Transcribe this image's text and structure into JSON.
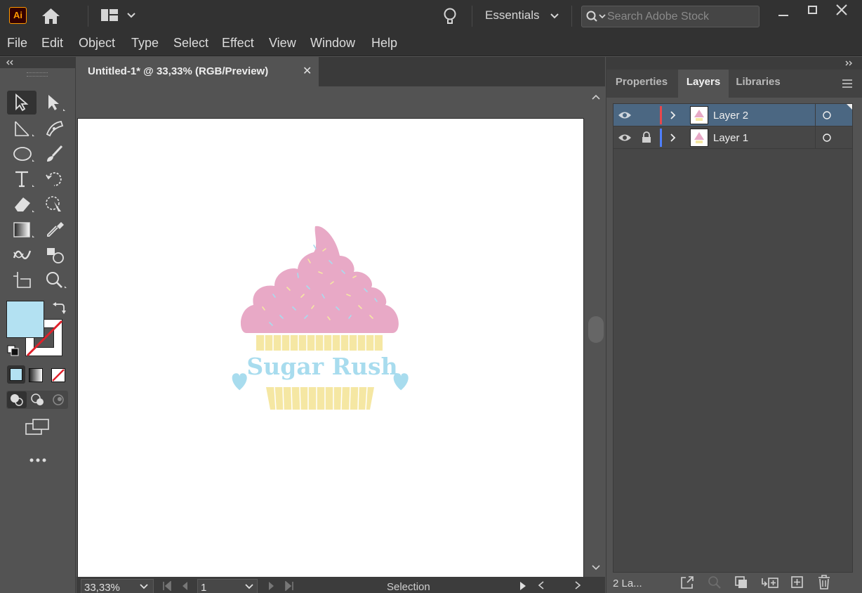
{
  "app": {
    "logo": "Ai",
    "workspace": "Essentials",
    "search_placeholder": "Search Adobe Stock"
  },
  "menu": [
    "File",
    "Edit",
    "Object",
    "Type",
    "Select",
    "Effect",
    "View",
    "Window",
    "Help"
  ],
  "document": {
    "tab_title": "Untitled-1* @ 33,33% (RGB/Preview)",
    "close": "✕",
    "artwork_text": "Sugar Rush"
  },
  "statusbar": {
    "zoom": "33,33%",
    "page": "1",
    "tool": "Selection"
  },
  "panel": {
    "tabs": [
      "Properties",
      "Layers",
      "Libraries"
    ],
    "active_tab": "Layers",
    "layers": [
      {
        "name": "Layer 2",
        "color": "#e8474c",
        "locked": false,
        "selected": true
      },
      {
        "name": "Layer 1",
        "color": "#4f7fff",
        "locked": true,
        "selected": false
      }
    ],
    "footer": "2 La..."
  },
  "colors": {
    "fill": "#b3e1f2",
    "frosting": "#e8a9c6",
    "wrapper": "#f5e7a3",
    "text": "#a8dcee"
  }
}
